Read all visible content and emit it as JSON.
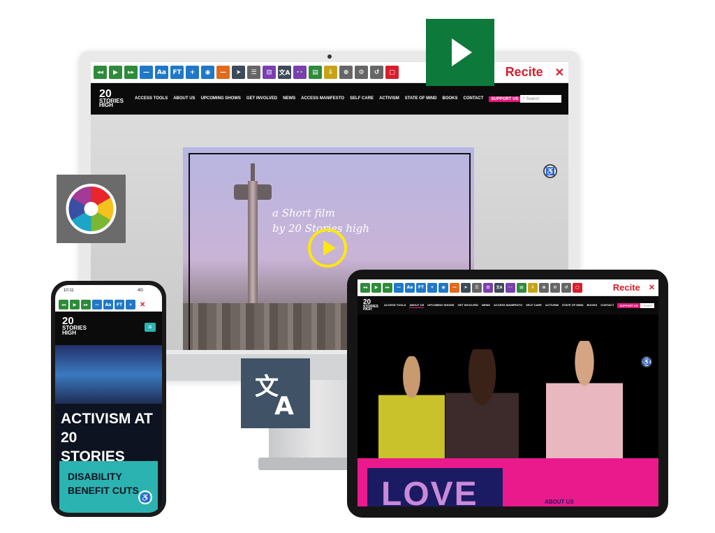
{
  "recite": {
    "logo": "Recite",
    "close": "✕",
    "buttons": [
      "◂◂",
      "▶",
      "▸▸",
      "—",
      "Aa",
      "FT",
      "+",
      "◉",
      "—",
      "➤",
      "☰",
      "⊡",
      "文A",
      "👓",
      "▤",
      "⇩",
      "⊕",
      "⚙",
      "↺",
      "▢"
    ]
  },
  "site": {
    "logo_top": "20",
    "logo_mid": "STORIES",
    "logo_bot": "HIGH",
    "nav": [
      "ACCESS TOOLS",
      "ABOUT US",
      "UPCOMING SHOWS",
      "GET INVOLVED",
      "NEWS",
      "ACCESS MANIFESTO",
      "SELF CARE",
      "ACTIVISM",
      "STATE OF MIND",
      "BOOKS",
      "CONTACT"
    ],
    "support": "SUPPORT US",
    "search_placeholder": "Search"
  },
  "hero": {
    "line1": "a Short film",
    "line2": "by 20 Stories high"
  },
  "phone": {
    "time": "10:11",
    "status": "4G",
    "headline1": "ACTIVISM AT 20",
    "headline2": "STORIES HIGH",
    "card1": "DISABILITY",
    "card2": "BENEFIT CUTS"
  },
  "ipad": {
    "banner_text": "LOVE",
    "about_label": "ABOUT US"
  },
  "icons": {
    "play_badge": "play-icon",
    "color_badge": "color-wheel-icon",
    "translate_badge": "translate-icon",
    "accessibility": "accessibility-icon"
  },
  "colors": {
    "recite_red": "#d81e2c",
    "support_pink": "#e3197b",
    "play_yellow": "#ffe712",
    "badge_green": "#0d7a3c",
    "ipad_pink": "#ea1a8c",
    "phone_teal": "#2bb3b1"
  }
}
